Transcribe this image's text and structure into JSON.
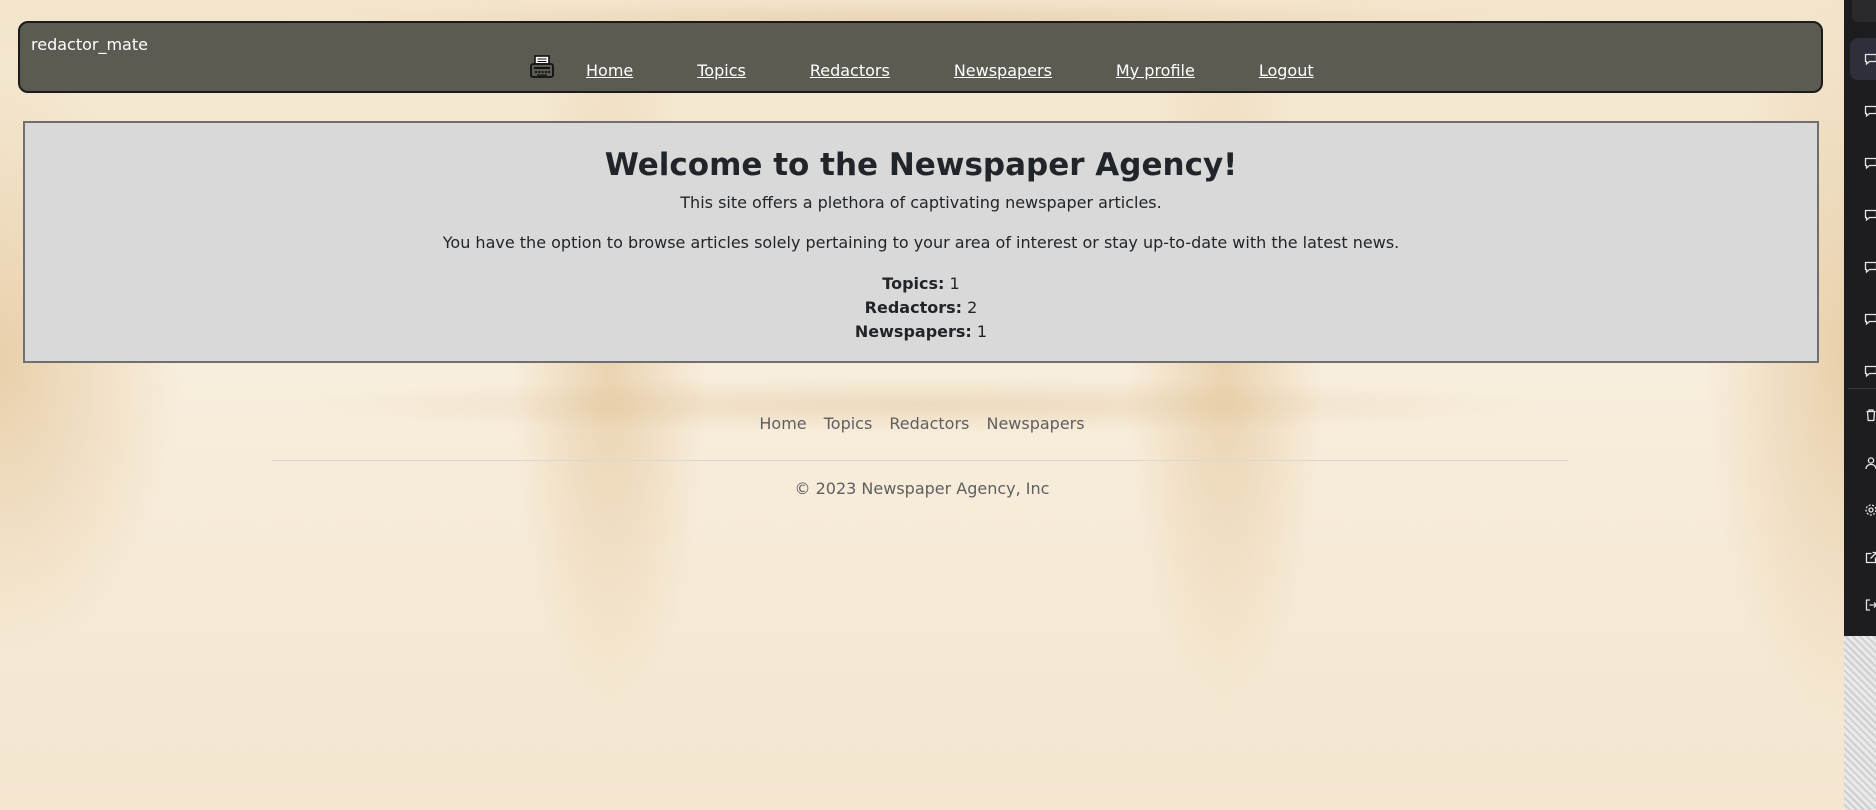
{
  "navbar": {
    "brand": "redactor_mate",
    "icon": "typewriter-icon",
    "links": [
      "Home",
      "Topics",
      "Redactors",
      "Newspapers",
      "My profile",
      "Logout"
    ],
    "background_color": "#5b5b52"
  },
  "welcome": {
    "title": "Welcome to the Newspaper Agency!",
    "line1": "This site offers a plethora of captivating newspaper articles.",
    "line2": "You have the option to browse articles solely pertaining to your area of interest or stay up-to-date with the latest news.",
    "stats": [
      {
        "label": "Topics:",
        "value": "1"
      },
      {
        "label": "Redactors:",
        "value": "2"
      },
      {
        "label": "Newspapers:",
        "value": "1"
      }
    ],
    "background_color": "#d9d9d9"
  },
  "footer": {
    "links": [
      "Home",
      "Topics",
      "Redactors",
      "Newspapers"
    ],
    "copyright": "© 2023 Newspaper Agency, Inc"
  },
  "right_dock": {
    "icons": [
      "chat-icon",
      "chat-icon",
      "chat-icon",
      "chat-icon",
      "chat-icon",
      "chat-icon",
      "chat-icon",
      "trash-icon",
      "user-icon",
      "gear-icon",
      "external-link-icon",
      "logout-icon"
    ]
  }
}
